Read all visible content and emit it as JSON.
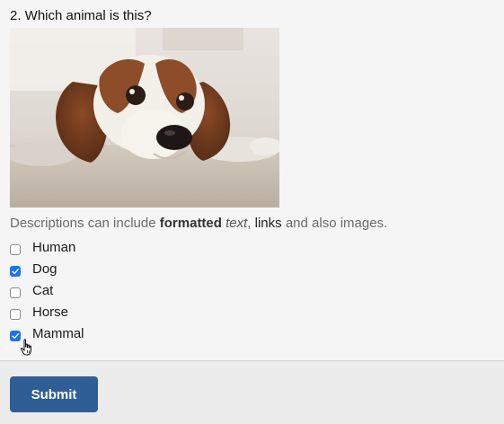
{
  "question": {
    "title": "2. Which animal is this?",
    "image_alt": "dog-photo"
  },
  "description": {
    "prefix": "Descriptions can include ",
    "bold": "formatted",
    "italic": "text",
    "sep": ", ",
    "link": "links",
    "suffix": " and also images."
  },
  "options": [
    {
      "label": "Human",
      "checked": false
    },
    {
      "label": "Dog",
      "checked": true
    },
    {
      "label": "Cat",
      "checked": false
    },
    {
      "label": "Horse",
      "checked": false
    },
    {
      "label": "Mammal",
      "checked": true
    }
  ],
  "footer": {
    "submit_label": "Submit"
  },
  "colors": {
    "accent": "#1a73e8",
    "button": "#2f5e96"
  }
}
